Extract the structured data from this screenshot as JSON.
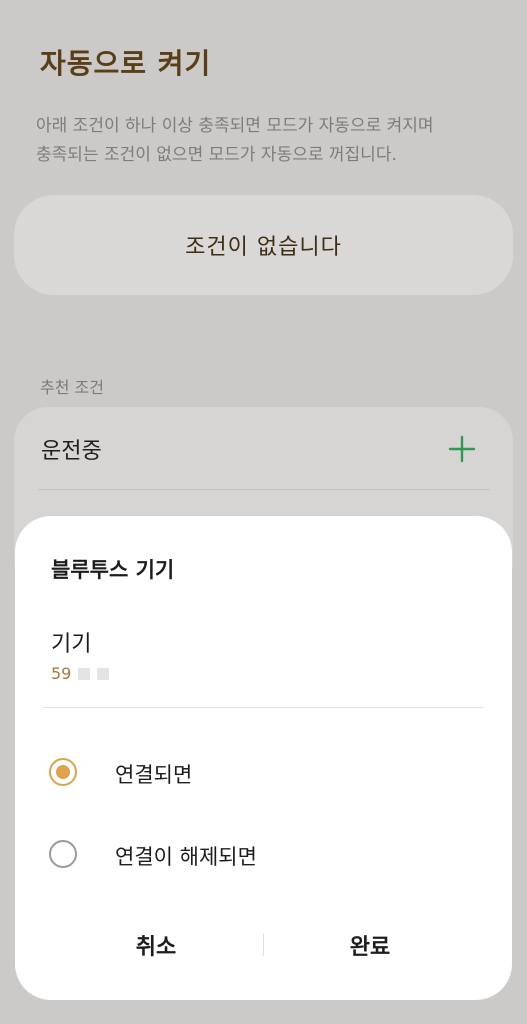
{
  "header": {
    "title": "자동으로 켜기",
    "description_line1": "아래 조건이 하나 이상 충족되면 모드가 자동으로 켜지며",
    "description_line2": "충족되는 조건이 없으면 모드가 자동으로 꺼집니다."
  },
  "conditions": {
    "empty_text": "조건이 없습니다"
  },
  "recommended": {
    "section_label": "추천 조건",
    "items": [
      {
        "label": "운전중",
        "icon": "plus-icon"
      }
    ]
  },
  "sheet": {
    "title": "블루투스 기기",
    "device_label": "기기",
    "device_value": "59",
    "options": [
      {
        "label": "연결되면",
        "selected": true
      },
      {
        "label": "연결이 해제되면",
        "selected": false
      }
    ],
    "cancel_label": "취소",
    "done_label": "완료"
  },
  "colors": {
    "background_dim": "#cbcac8",
    "title_brown": "#5a3e16",
    "accent_orange": "#e0a24a",
    "add_green": "#2e9a4e",
    "device_value": "#a47a3a"
  }
}
